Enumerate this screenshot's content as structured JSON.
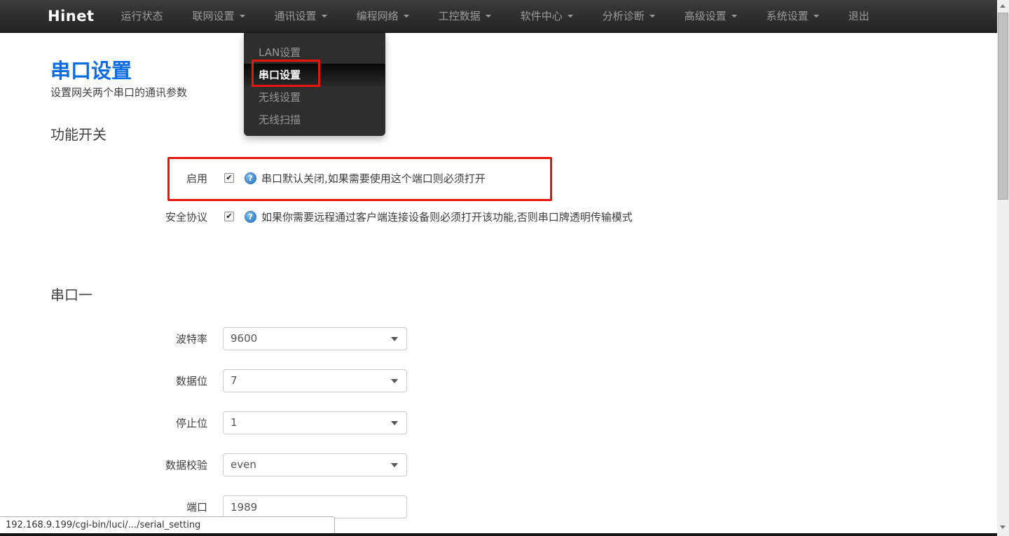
{
  "navbar": {
    "brand": "Hinet",
    "items": [
      {
        "label": "运行状态"
      },
      {
        "label": "联网设置"
      },
      {
        "label": "通讯设置"
      },
      {
        "label": "编程网络"
      },
      {
        "label": "工控数据"
      },
      {
        "label": "软件中心"
      },
      {
        "label": "分析诊断"
      },
      {
        "label": "高级设置"
      },
      {
        "label": "系统设置"
      },
      {
        "label": "退出"
      }
    ]
  },
  "dropdown": {
    "items": [
      {
        "label": "LAN设置",
        "active": false
      },
      {
        "label": "串口设置",
        "active": true
      },
      {
        "label": "无线设置",
        "active": false
      },
      {
        "label": "无线扫描",
        "active": false
      }
    ]
  },
  "page": {
    "title": "串口设置",
    "subtitle": "设置网关两个串口的通讯参数"
  },
  "switches": {
    "heading": "功能开关",
    "rows": [
      {
        "label": "启用",
        "checked": true,
        "help": "串口默认关闭,如果需要使用这个端口则必须打开"
      },
      {
        "label": "安全协议",
        "checked": true,
        "help": "如果你需要远程通过客户端连接设备则必须打开该功能,否则串口牌透明传输模式"
      }
    ]
  },
  "serial1": {
    "heading": "串口一",
    "fields": [
      {
        "label": "波特率",
        "value": "9600",
        "type": "select"
      },
      {
        "label": "数据位",
        "value": "7",
        "type": "select"
      },
      {
        "label": "停止位",
        "value": "1",
        "type": "select"
      },
      {
        "label": "数据校验",
        "value": "even",
        "type": "select"
      },
      {
        "label": "端口",
        "value": "1989",
        "type": "input"
      }
    ]
  },
  "statusbar": {
    "url": "192.168.9.199/cgi-bin/luci/.../serial_setting"
  },
  "icons": {
    "help_glyph": "?",
    "check_glyph": "✔"
  },
  "colors": {
    "title_blue": "#0c6ce0",
    "annotation_red": "#e8150c",
    "navbar_dark": "#222222"
  }
}
